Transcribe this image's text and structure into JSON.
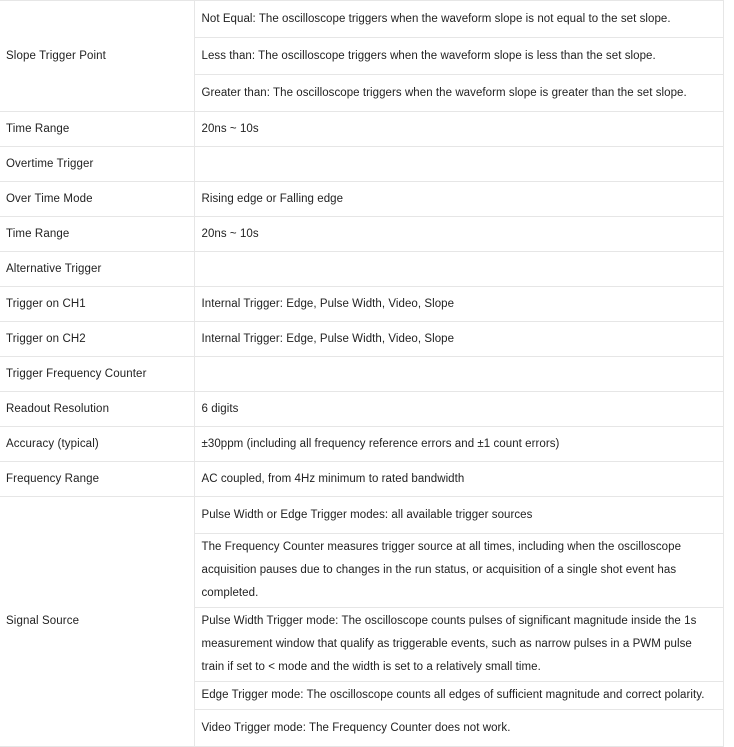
{
  "document": {
    "type": "specification-table",
    "column_count": 2
  },
  "table": {
    "rows": [
      {
        "label": "Slope Trigger Point",
        "label_rowspan": 3,
        "values": [
          "Not Equal: The oscilloscope triggers when the waveform slope is not equal to the set slope.",
          "Less than: The oscilloscope triggers when the waveform slope is less than the set slope.",
          "Greater than: The oscilloscope triggers when the waveform slope is greater than the set slope."
        ]
      },
      {
        "label": "Time Range",
        "label_rowspan": 1,
        "values": [
          "20ns ~ 10s"
        ]
      },
      {
        "label": "Overtime Trigger",
        "label_rowspan": 1,
        "values": [
          ""
        ]
      },
      {
        "label": "Over Time Mode",
        "label_rowspan": 1,
        "values": [
          "Rising edge or Falling edge"
        ]
      },
      {
        "label": "Time Range",
        "label_rowspan": 1,
        "values": [
          "20ns ~ 10s"
        ]
      },
      {
        "label": "Alternative Trigger",
        "label_rowspan": 1,
        "values": [
          ""
        ]
      },
      {
        "label": "Trigger on CH1",
        "label_rowspan": 1,
        "values": [
          "Internal Trigger: Edge, Pulse Width, Video, Slope"
        ]
      },
      {
        "label": "Trigger on CH2",
        "label_rowspan": 1,
        "values": [
          "Internal Trigger: Edge, Pulse Width, Video, Slope"
        ]
      },
      {
        "label": "Trigger Frequency Counter",
        "label_rowspan": 1,
        "values": [
          ""
        ]
      },
      {
        "label": "Readout Resolution",
        "label_rowspan": 1,
        "values": [
          "6 digits"
        ]
      },
      {
        "label": "Accuracy (typical)",
        "label_rowspan": 1,
        "values": [
          "±30ppm (including all frequency reference errors and ±1 count errors)"
        ]
      },
      {
        "label": "Frequency Range",
        "label_rowspan": 1,
        "values": [
          "AC coupled, from 4Hz minimum to rated bandwidth"
        ]
      },
      {
        "label": "Signal Source",
        "label_rowspan": 5,
        "values": [
          "Pulse Width or Edge Trigger modes: all available trigger sources",
          "The Frequency Counter measures trigger source at all times, including when the oscilloscope acquisition pauses due to changes in the run status, or acquisition of a single shot event has completed.",
          "Pulse Width Trigger mode: The oscilloscope counts pulses of significant magnitude inside the 1s measurement window that qualify as triggerable events, such as narrow pulses in a PWM pulse train if set to < mode and the width is set to a relatively small time.",
          "Edge Trigger mode: The oscilloscope counts all edges of sufficient magnitude and correct polarity.",
          "Video Trigger mode: The Frequency Counter does not work."
        ]
      }
    ]
  },
  "style": {
    "border_color": "#e6e6e6",
    "text_color": "#222222",
    "background_color": "#ffffff"
  }
}
